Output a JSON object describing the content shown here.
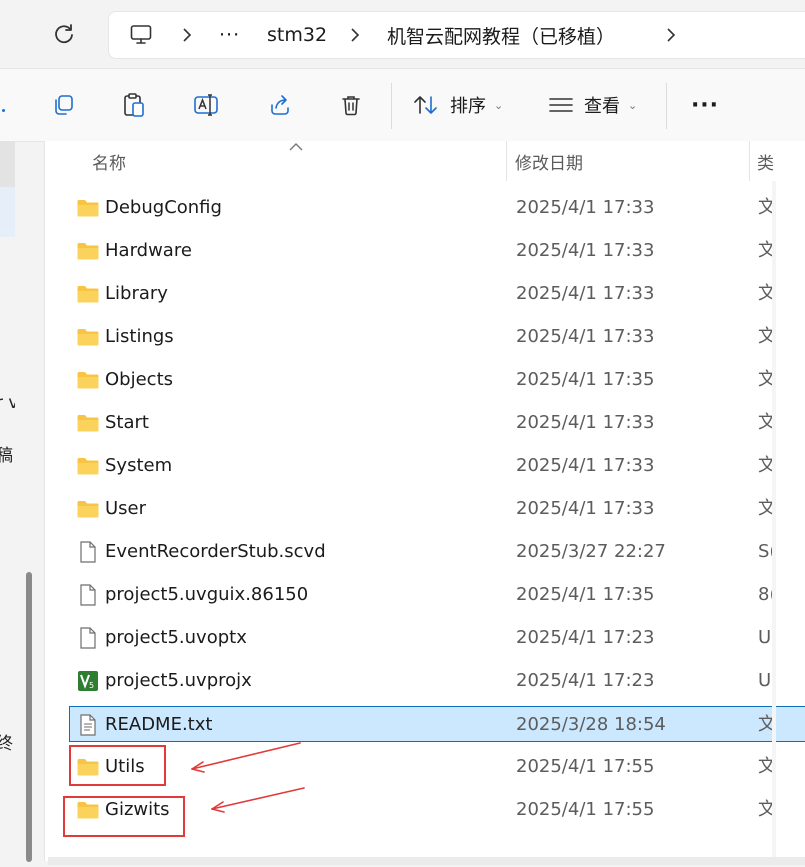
{
  "address_bar": {
    "path": [
      "stm32",
      "机智云配网教程（已移植）"
    ],
    "more_label": "···"
  },
  "toolbar": {
    "sort_label": "排序",
    "view_label": "查看",
    "more_label": "···"
  },
  "nav_fragments": [
    "r v",
    "稿",
    "终"
  ],
  "columns": {
    "name": "名称",
    "date": "修改日期",
    "type": "类"
  },
  "files": [
    {
      "name": "DebugConfig",
      "date": "2025/4/1 17:33",
      "type": "文",
      "icon": "folder-icon"
    },
    {
      "name": "Hardware",
      "date": "2025/4/1 17:33",
      "type": "文",
      "icon": "folder-icon"
    },
    {
      "name": "Library",
      "date": "2025/4/1 17:33",
      "type": "文",
      "icon": "folder-icon"
    },
    {
      "name": "Listings",
      "date": "2025/4/1 17:33",
      "type": "文",
      "icon": "folder-icon"
    },
    {
      "name": "Objects",
      "date": "2025/4/1 17:35",
      "type": "文",
      "icon": "folder-icon"
    },
    {
      "name": "Start",
      "date": "2025/4/1 17:33",
      "type": "文",
      "icon": "folder-icon"
    },
    {
      "name": "System",
      "date": "2025/4/1 17:33",
      "type": "文",
      "icon": "folder-icon"
    },
    {
      "name": "User",
      "date": "2025/4/1 17:33",
      "type": "文",
      "icon": "folder-icon"
    },
    {
      "name": "EventRecorderStub.scvd",
      "date": "2025/3/27 22:27",
      "type": "S(",
      "icon": "file-icon"
    },
    {
      "name": "project5.uvguix.86150",
      "date": "2025/4/1 17:35",
      "type": "8(",
      "icon": "file-icon"
    },
    {
      "name": "project5.uvoptx",
      "date": "2025/4/1 17:23",
      "type": "U",
      "icon": "file-icon"
    },
    {
      "name": "project5.uvprojx",
      "date": "2025/4/1 17:23",
      "type": "U",
      "icon": "keil-project-icon"
    },
    {
      "name": "README.txt",
      "date": "2025/3/28 18:54",
      "type": "文",
      "icon": "text-file-icon",
      "selected": true
    },
    {
      "name": "Utils",
      "date": "2025/4/1 17:55",
      "type": "文",
      "icon": "folder-icon"
    },
    {
      "name": "Gizwits",
      "date": "2025/4/1 17:55",
      "type": "文",
      "icon": "folder-icon"
    }
  ],
  "colors": {
    "folder": "#f8c543",
    "selection": "#cce8ff",
    "annotation": "#e03a3a"
  }
}
